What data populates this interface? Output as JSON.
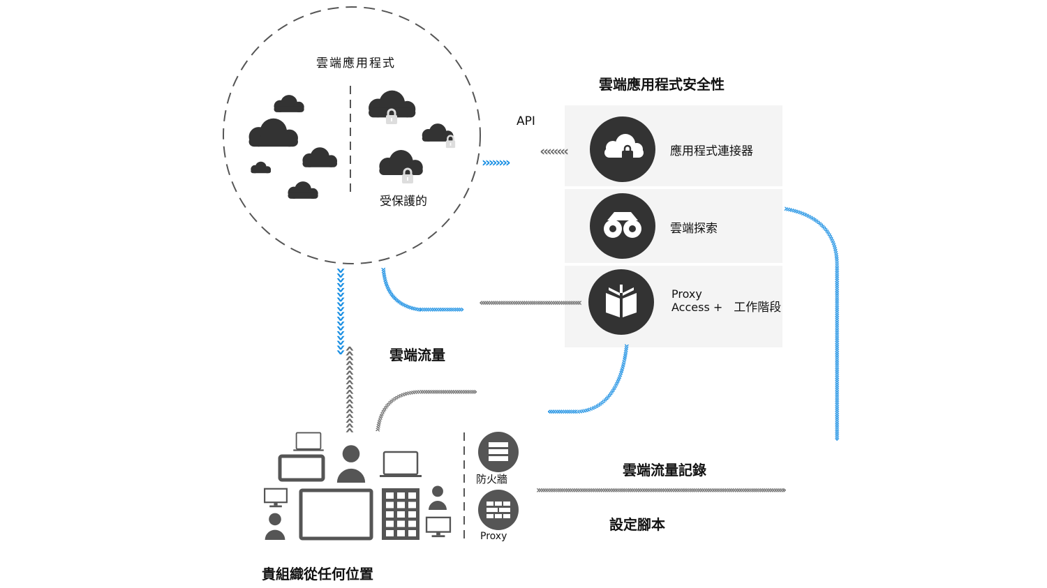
{
  "cloud_apps": {
    "title": "雲端應用程式",
    "protected_label": "受保護的"
  },
  "security": {
    "title": "雲端應用程式安全性",
    "items": [
      {
        "label": "應用程式連接器",
        "icon": "cloud-lock-icon"
      },
      {
        "label": "雲端探索",
        "icon": "binoculars-icon"
      },
      {
        "label_line1": "Proxy",
        "label_line2": "Access +",
        "label_extra": "工作階段",
        "icon": "open-book-icon"
      }
    ]
  },
  "api_label": "API",
  "traffic_label": "雲端流量",
  "traffic_logs_label": "雲端流量記錄",
  "scripts_label": "設定腳本",
  "org_label": "貴組織從任何位置",
  "firewall_label": "防火牆",
  "proxy_label": "Proxy",
  "colors": {
    "blue": "#1a8fe3",
    "gray": "#6b6b6b",
    "dark": "#333333",
    "panel": "#f4f4f4"
  }
}
